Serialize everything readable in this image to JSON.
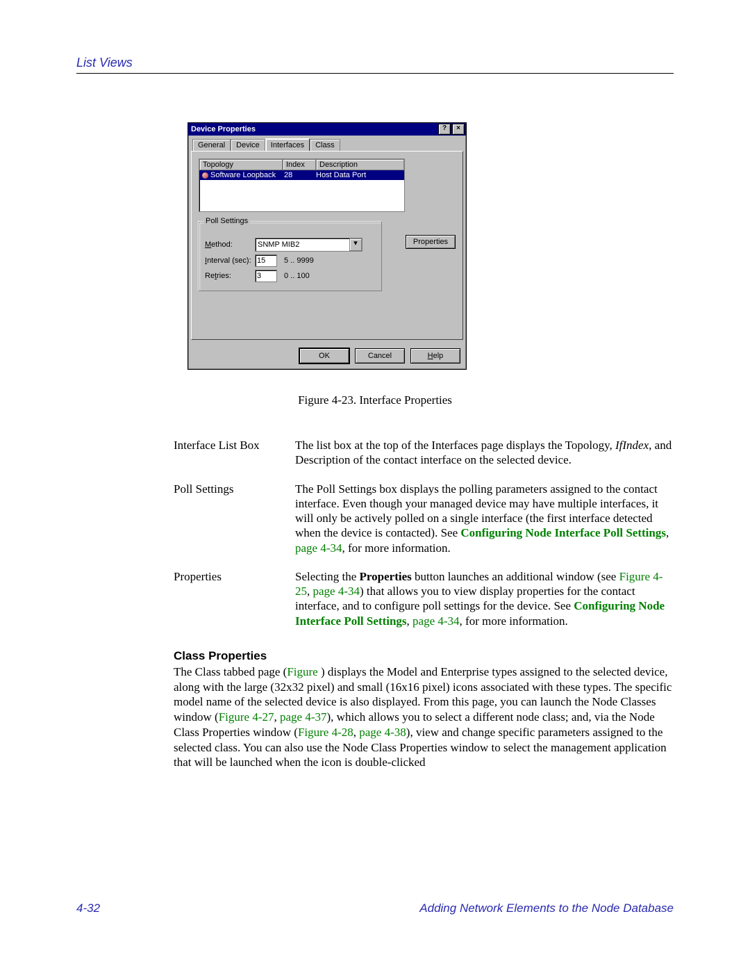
{
  "header": {
    "running_head": "List Views"
  },
  "dialog": {
    "title": "Device Properties",
    "help_btn": "?",
    "close_btn": "×",
    "tabs": {
      "general": "General",
      "device": "Device",
      "interfaces": "Interfaces",
      "class": "Class"
    },
    "list_headers": {
      "topology": "Topology",
      "index": "Index",
      "description": "Description"
    },
    "list_row": {
      "topology": "Software Loopback",
      "index": "28",
      "description": "Host Data Port"
    },
    "groupbox_title": "Poll Settings",
    "method_label": "Method:",
    "method_value": "SNMP MIB2",
    "interval_label": "Interval (sec):",
    "interval_value": "15",
    "interval_range": "5 .. 9999",
    "retries_label": "Retries:",
    "retries_value": "3",
    "retries_range": "0 .. 100",
    "properties_btn": "Properties",
    "ok": "OK",
    "cancel": "Cancel",
    "help": "Help"
  },
  "caption": "Figure 4-23.  Interface Properties",
  "dl": {
    "ilb_term": "Interface List Box",
    "ilb_def_1": "The list box at the top of the Interfaces page displays the Topology, ",
    "ilb_def_ital": "IfIndex",
    "ilb_def_2": ", and Description of the contact interface on the selected device.",
    "ps_term": "Poll Settings",
    "ps_def_1": "The Poll Settings box displays the polling parameters assigned to the contact interface. Even though your managed device may have multiple interfaces, it will only be actively polled on a single interface (the first interface detected when the device is contacted). See ",
    "ps_link1": "Configuring Node Interface Poll Settings",
    "ps_def_2": ", ",
    "ps_link2": "page 4-34",
    "ps_def_3": ", for more information.",
    "pr_term": "Properties",
    "pr_def_1": "Selecting the ",
    "pr_bold": "Properties",
    "pr_def_2": " button launches an additional window (see ",
    "pr_link1": "Figure 4-25",
    "pr_def_2b": ", ",
    "pr_link1b": "page 4-34",
    "pr_def_3": ") that allows you to view display properties for the contact interface, and to configure poll settings for the device. See ",
    "pr_link2": "Configuring Node Interface Poll Settings",
    "pr_def_4": ", ",
    "pr_link3": "page 4-34",
    "pr_def_5": ", for more information."
  },
  "class_section": {
    "heading": "Class Properties",
    "p1a": "The Class tabbed page (",
    "p1_link1": "Figure ",
    "p1b": ") displays the Model and Enterprise types assigned to the selected device, along with the large (32x32 pixel) and small (16x16 pixel) icons associated with these types. The specific model name of the selected device is also displayed. From this page, you can launch the Node Classes window (",
    "p1_link2": "Figure 4-27",
    "p1c": ", ",
    "p1_link3": "page 4-37",
    "p1d": "), which allows you to select a different node class; and, via the Node Class Properties window (",
    "p1_link4": "Figure 4-28",
    "p1e": ", ",
    "p1_link5": "page 4-38",
    "p1f": "), view and change specific parameters assigned to the selected class. You can also use the Node Class Properties window to select the management application that will be launched when the icon is double-clicked"
  },
  "footer": {
    "page": "4-32",
    "chapter": "Adding Network Elements to the Node Database"
  }
}
